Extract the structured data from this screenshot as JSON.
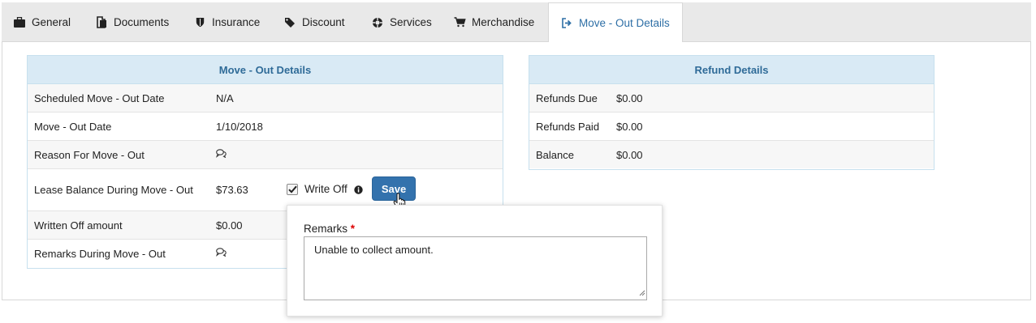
{
  "tabs": [
    {
      "label": "General",
      "icon": "briefcase-icon"
    },
    {
      "label": "Documents",
      "icon": "documents-icon"
    },
    {
      "label": "Insurance",
      "icon": "shield-icon"
    },
    {
      "label": "Discount",
      "icon": "tags-icon"
    },
    {
      "label": "Services",
      "icon": "lifebuoy-icon"
    },
    {
      "label": "Merchandise",
      "icon": "cart-icon"
    },
    {
      "label": "Move - Out Details",
      "icon": "sign-out-icon",
      "active": true
    }
  ],
  "move_out": {
    "title": "Move - Out Details",
    "rows": [
      {
        "label": "Scheduled Move - Out Date",
        "value": "N/A"
      },
      {
        "label": "Move - Out Date",
        "value": "1/10/2018"
      },
      {
        "label": "Reason For Move - Out",
        "value": "",
        "icon": "comments-icon"
      },
      {
        "label": "Lease Balance During Move - Out",
        "value": "$73.63"
      },
      {
        "label": "Written Off amount",
        "value": "$0.00"
      },
      {
        "label": "Remarks During Move - Out",
        "value": "",
        "icon": "comments-icon"
      }
    ],
    "write_off_label": "Write Off",
    "write_off_checked": true,
    "save_label": "Save"
  },
  "refund": {
    "title": "Refund Details",
    "rows": [
      {
        "label": "Refunds Due",
        "value": "$0.00"
      },
      {
        "label": "Refunds Paid",
        "value": "$0.00"
      },
      {
        "label": "Balance",
        "value": "$0.00"
      }
    ]
  },
  "remarks_popup": {
    "label": "Remarks",
    "required_mark": "*",
    "value": "Unable to collect amount."
  },
  "colors": {
    "accent": "#2e6fa6",
    "header_bg": "#d9eaf5",
    "button": "#3372ad"
  }
}
